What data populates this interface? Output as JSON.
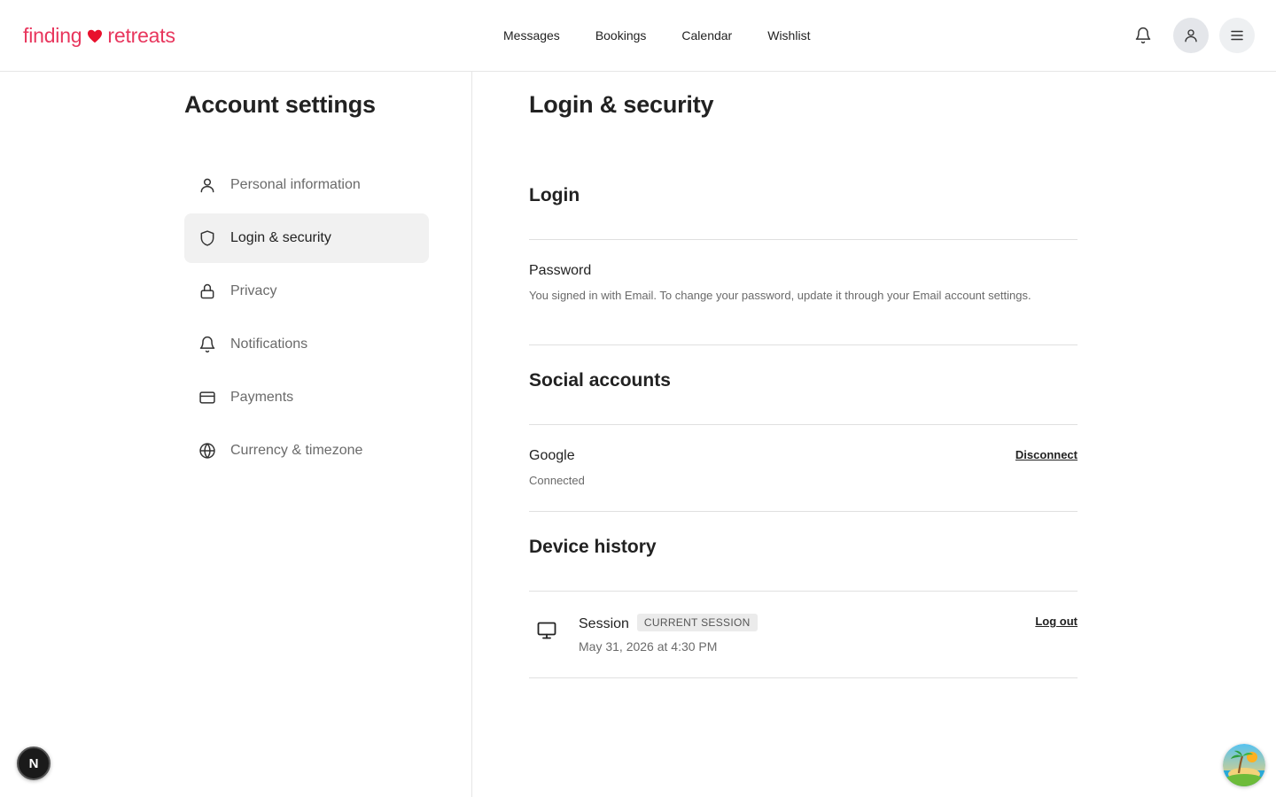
{
  "header": {
    "logo_left": "finding",
    "logo_right": "retreats",
    "nav": [
      "Messages",
      "Bookings",
      "Calendar",
      "Wishlist"
    ]
  },
  "sidebar": {
    "title": "Account settings",
    "items": [
      {
        "label": "Personal information",
        "icon": "user-icon"
      },
      {
        "label": "Login & security",
        "icon": "shield-icon",
        "active": true
      },
      {
        "label": "Privacy",
        "icon": "lock-icon"
      },
      {
        "label": "Notifications",
        "icon": "bell-icon"
      },
      {
        "label": "Payments",
        "icon": "credit-card-icon"
      },
      {
        "label": "Currency & timezone",
        "icon": "globe-icon"
      }
    ]
  },
  "main": {
    "title": "Login & security",
    "login": {
      "heading": "Login",
      "password_title": "Password",
      "password_desc": "You signed in with Email. To change your password, update it through your Email account settings."
    },
    "social": {
      "heading": "Social accounts",
      "google_title": "Google",
      "google_status": "Connected",
      "disconnect_label": "Disconnect"
    },
    "devices": {
      "heading": "Device history",
      "session_title": "Session",
      "session_badge": "CURRENT SESSION",
      "session_time": "May 31, 2026 at 4:30 PM",
      "logout_label": "Log out"
    }
  },
  "floating": {
    "n_badge": "N"
  },
  "colors": {
    "brand": "#e8365d",
    "text": "#222222",
    "muted": "#6a6a6a",
    "divider": "#e0e0e0"
  }
}
